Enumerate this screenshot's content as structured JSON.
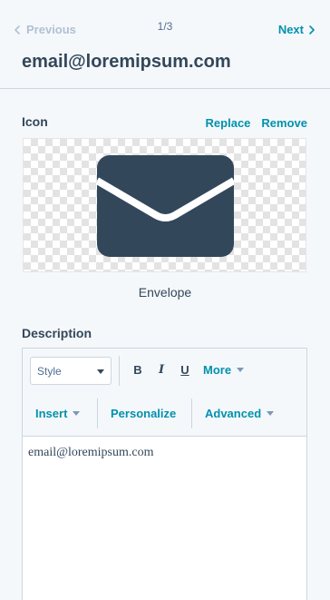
{
  "header": {
    "prev_label": "Previous",
    "pager": "1/3",
    "next_label": "Next",
    "title": "email@loremipsum.com"
  },
  "icon_section": {
    "label": "Icon",
    "replace_label": "Replace",
    "remove_label": "Remove",
    "icon_name": "Envelope",
    "icon_semantic": "envelope-icon",
    "icon_color": "#33475b"
  },
  "description": {
    "label": "Description",
    "toolbar": {
      "style_value": "Style",
      "bold": "B",
      "italic": "I",
      "underline": "U",
      "more_label": "More",
      "insert_label": "Insert",
      "personalize_label": "Personalize",
      "advanced_label": "Advanced"
    },
    "content": "email@loremipsum.com"
  },
  "colors": {
    "accent": "#0091ae",
    "text": "#33475b",
    "background": "#f5f8fa",
    "border": "#cbd6e2"
  }
}
